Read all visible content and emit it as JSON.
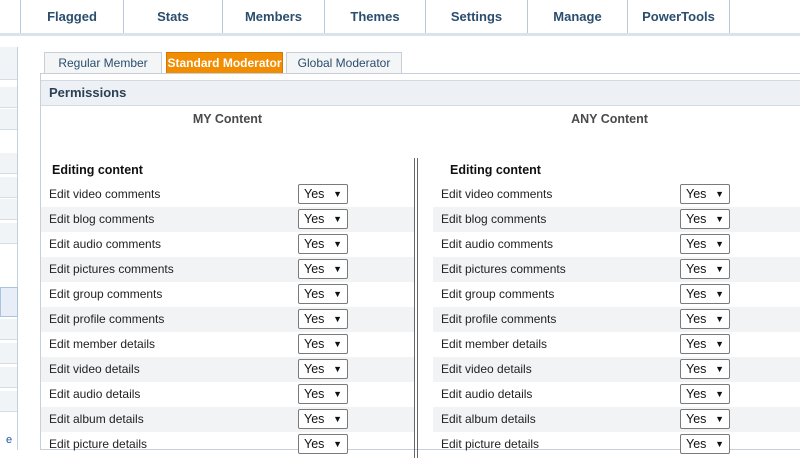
{
  "nav": {
    "items": [
      "Flagged",
      "Stats",
      "Members",
      "Themes",
      "Settings",
      "Manage",
      "PowerTools"
    ]
  },
  "sidebar": {
    "edge_text": "e"
  },
  "tabs": {
    "items": [
      "Regular Member",
      "Standard Moderator",
      "Global Moderator"
    ],
    "active": "Standard Moderator"
  },
  "panel": {
    "title": "Permissions",
    "my_header": "MY Content",
    "any_header": "ANY Content",
    "section_title": "Editing content"
  },
  "permissions": {
    "my": [
      {
        "label": "Edit video comments",
        "value": "Yes"
      },
      {
        "label": "Edit blog comments",
        "value": "Yes"
      },
      {
        "label": "Edit audio comments",
        "value": "Yes"
      },
      {
        "label": "Edit pictures comments",
        "value": "Yes"
      },
      {
        "label": "Edit group comments",
        "value": "Yes"
      },
      {
        "label": "Edit profile comments",
        "value": "Yes"
      },
      {
        "label": "Edit member details",
        "value": "Yes"
      },
      {
        "label": "Edit video details",
        "value": "Yes"
      },
      {
        "label": "Edit audio details",
        "value": "Yes"
      },
      {
        "label": "Edit album details",
        "value": "Yes"
      },
      {
        "label": "Edit picture details",
        "value": "Yes"
      }
    ],
    "any": [
      {
        "label": "Edit video comments",
        "value": "Yes"
      },
      {
        "label": "Edit blog comments",
        "value": "Yes"
      },
      {
        "label": "Edit audio comments",
        "value": "Yes"
      },
      {
        "label": "Edit pictures comments",
        "value": "Yes"
      },
      {
        "label": "Edit group comments",
        "value": "Yes"
      },
      {
        "label": "Edit profile comments",
        "value": "Yes"
      },
      {
        "label": "Edit member details",
        "value": "Yes"
      },
      {
        "label": "Edit video details",
        "value": "Yes"
      },
      {
        "label": "Edit audio details",
        "value": "Yes"
      },
      {
        "label": "Edit album details",
        "value": "Yes"
      },
      {
        "label": "Edit picture details",
        "value": "Yes"
      }
    ]
  },
  "colors": {
    "nav_text": "#2b4d6e",
    "active_tab": "#f28c00",
    "row_alt": "#f1f3f5"
  }
}
